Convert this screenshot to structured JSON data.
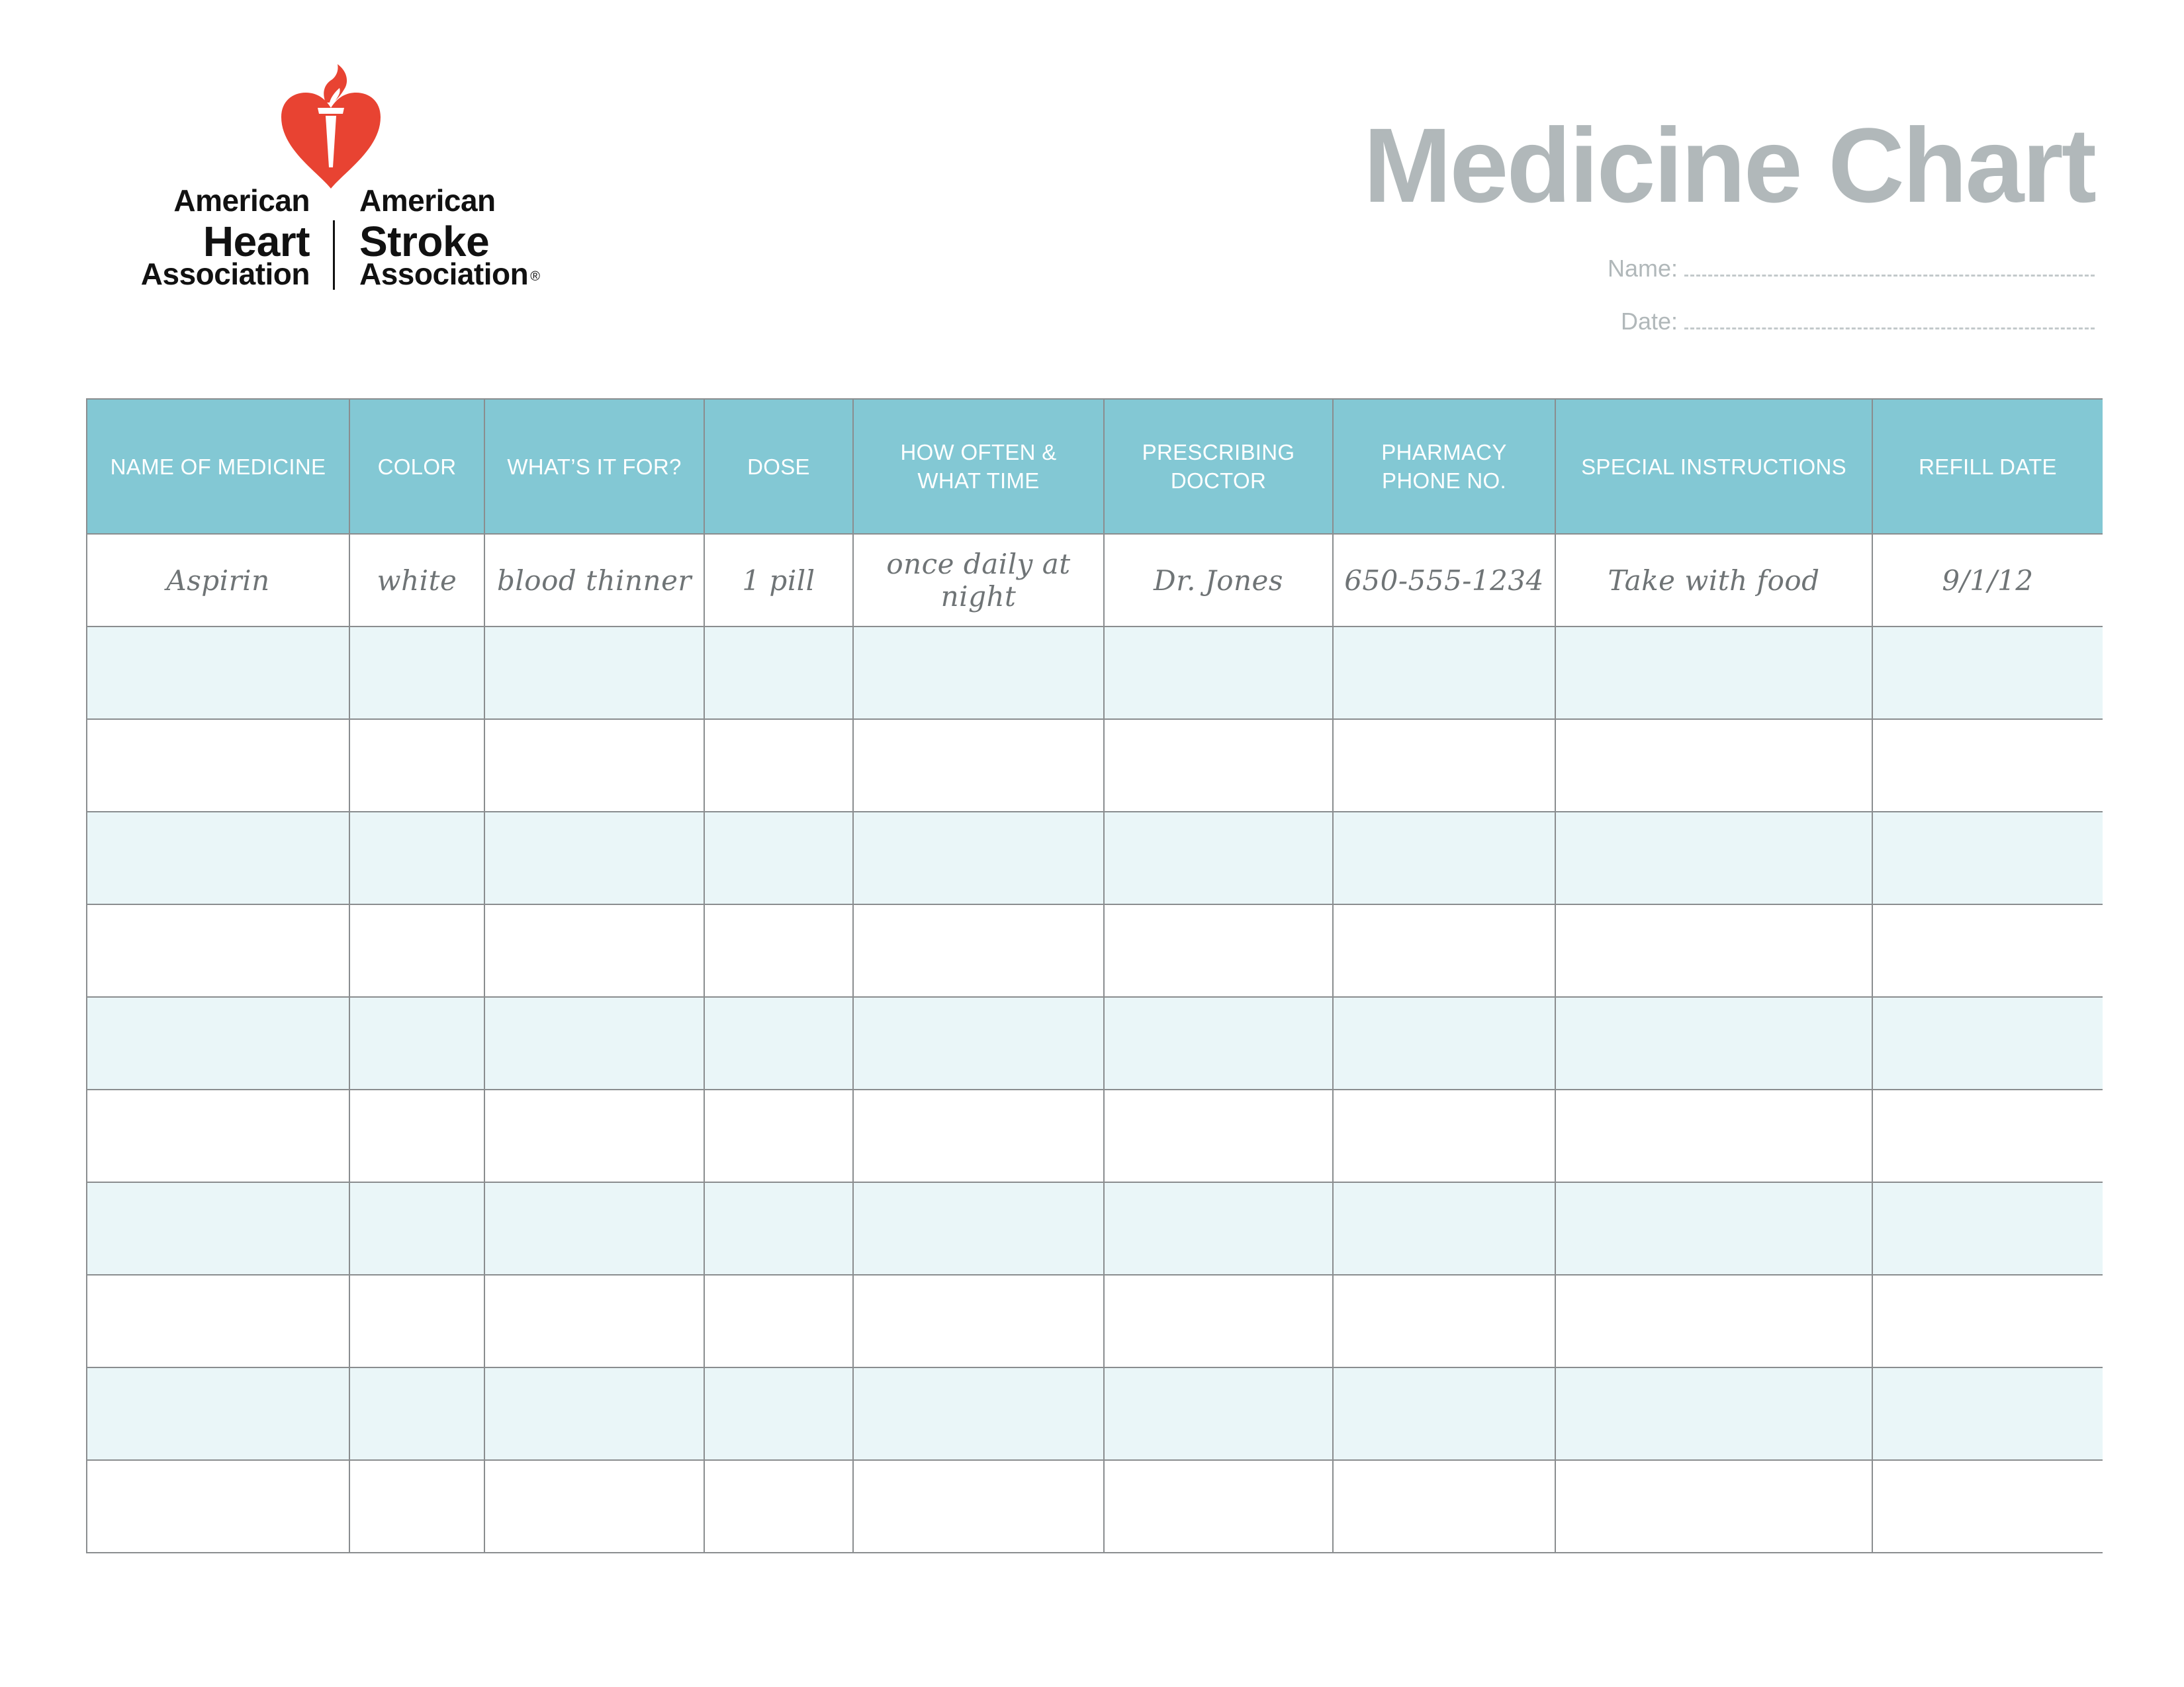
{
  "logo": {
    "icon": "heart-torch-icon",
    "left_lines": [
      "American",
      "Heart",
      "Association"
    ],
    "right_lines": [
      "American",
      "Stroke",
      "Association"
    ],
    "registered_mark": "®",
    "brand_color": "#E84332"
  },
  "header": {
    "title": "Medicine Chart",
    "name_label": "Name:",
    "date_label": "Date:",
    "name_value": "",
    "date_value": ""
  },
  "colors": {
    "header_bg": "#83C8D4",
    "alt_row_bg": "#EAF6F8",
    "title_gray": "#B1B8BA"
  },
  "table": {
    "columns": [
      "NAME OF MEDICINE",
      "COLOR",
      "WHAT'S IT FOR?",
      "DOSE",
      "HOW OFTEN & WHAT TIME",
      "PRESCRIBING DOCTOR",
      "PHARMACY PHONE NO.",
      "SPECIAL INSTRUCTIONS",
      "REFILL DATE"
    ],
    "column_lines": [
      [
        "NAME OF MEDICINE"
      ],
      [
        "COLOR"
      ],
      [
        "WHAT’S IT FOR?"
      ],
      [
        "DOSE"
      ],
      [
        "HOW OFTEN &",
        "WHAT TIME"
      ],
      [
        "PRESCRIBING",
        "DOCTOR"
      ],
      [
        "PHARMACY",
        "PHONE NO."
      ],
      [
        "SPECIAL INSTRUCTIONS"
      ],
      [
        "REFILL DATE"
      ]
    ],
    "rows": [
      [
        "Aspirin",
        "white",
        "blood thinner",
        "1 pill",
        "once daily at night",
        "Dr. Jones",
        "650-555-1234",
        "Take with food",
        "9/1/12"
      ],
      [
        "",
        "",
        "",
        "",
        "",
        "",
        "",
        "",
        ""
      ],
      [
        "",
        "",
        "",
        "",
        "",
        "",
        "",
        "",
        ""
      ],
      [
        "",
        "",
        "",
        "",
        "",
        "",
        "",
        "",
        ""
      ],
      [
        "",
        "",
        "",
        "",
        "",
        "",
        "",
        "",
        ""
      ],
      [
        "",
        "",
        "",
        "",
        "",
        "",
        "",
        "",
        ""
      ],
      [
        "",
        "",
        "",
        "",
        "",
        "",
        "",
        "",
        ""
      ],
      [
        "",
        "",
        "",
        "",
        "",
        "",
        "",
        "",
        ""
      ],
      [
        "",
        "",
        "",
        "",
        "",
        "",
        "",
        "",
        ""
      ],
      [
        "",
        "",
        "",
        "",
        "",
        "",
        "",
        "",
        ""
      ],
      [
        "",
        "",
        "",
        "",
        "",
        "",
        "",
        "",
        ""
      ]
    ]
  }
}
